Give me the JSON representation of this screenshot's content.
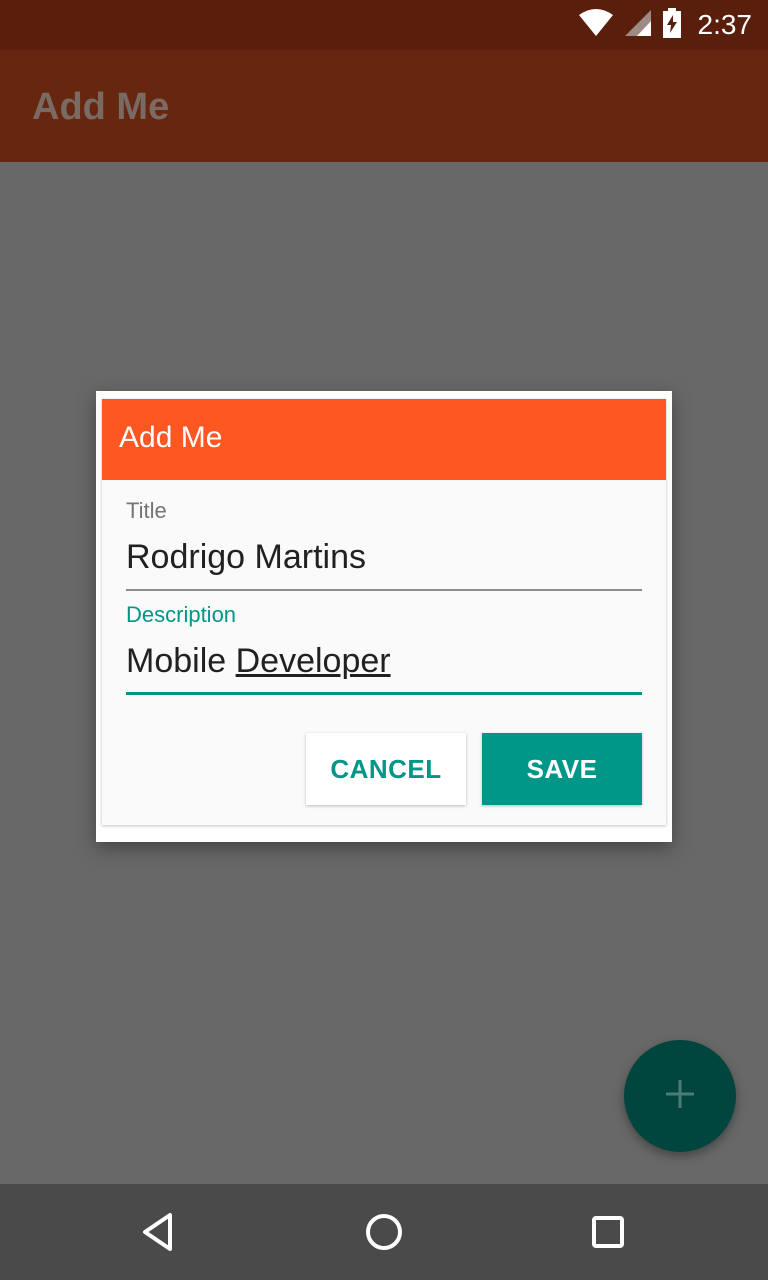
{
  "status_bar": {
    "time": "2:37",
    "icons": [
      "wifi-icon",
      "signal-icon",
      "battery-charging-icon"
    ]
  },
  "app_bar": {
    "title": "Add Me"
  },
  "dialog": {
    "header_title": "Add Me",
    "header_color": "#ff5722",
    "fields": {
      "title": {
        "label": "Title",
        "value": "Rodrigo Martins"
      },
      "description": {
        "label": "Description",
        "value_prefix": "Mobile ",
        "value_underlined": "Developer"
      }
    },
    "buttons": {
      "cancel": "CANCEL",
      "save": "SAVE"
    },
    "accent_color": "#009688"
  },
  "fab": {
    "icon": "plus-icon"
  },
  "nav_bar": {
    "icons": [
      "back-icon",
      "home-icon",
      "recents-icon"
    ]
  }
}
